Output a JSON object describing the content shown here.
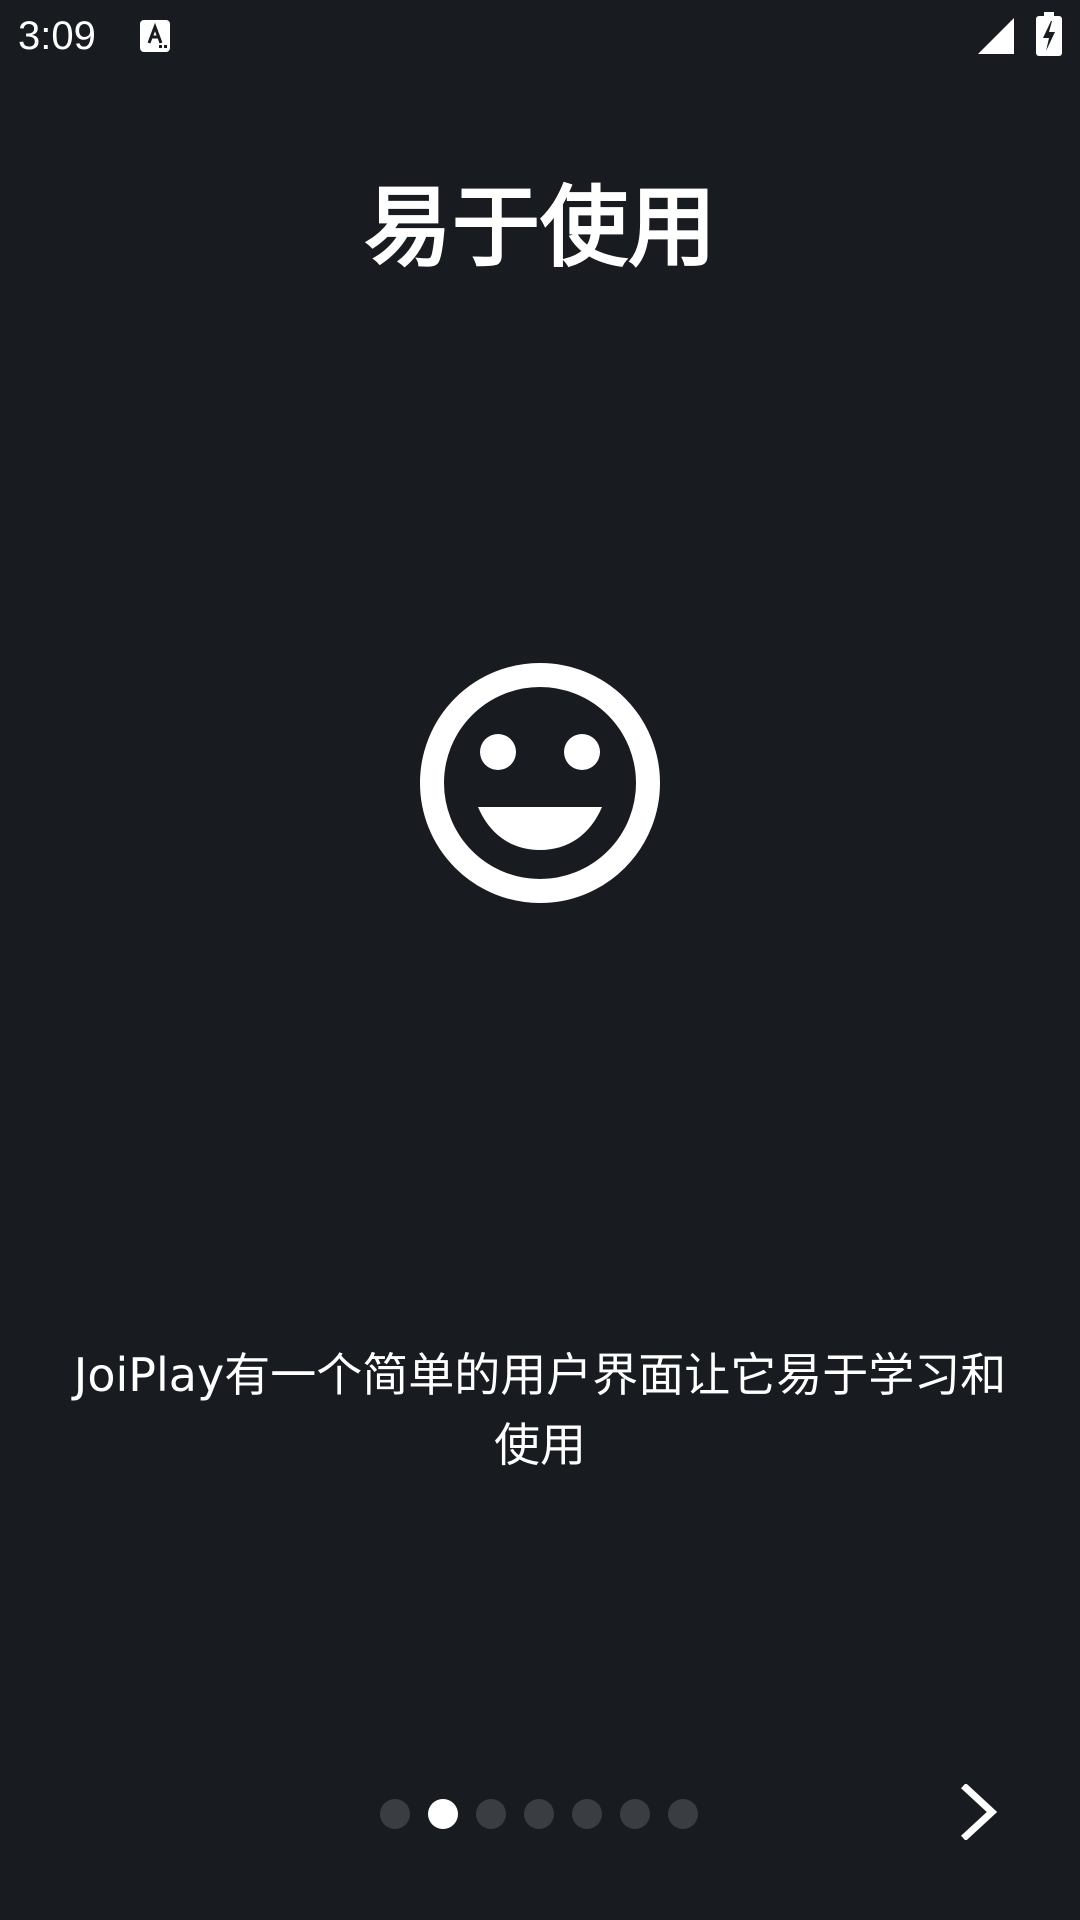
{
  "status_bar": {
    "time": "3:09",
    "icons": [
      "app-notification-icon",
      "signal-icon",
      "battery-charging-icon"
    ]
  },
  "onboarding": {
    "title": "易于使用",
    "hero_icon": "smiley-face-icon",
    "description_line1": "JoiPlay有一个简单的用户界面让它易于学习和",
    "description_line2": "使用",
    "pager": {
      "total_pages": 7,
      "current_page": 2
    },
    "next_icon": "chevron-right-icon"
  },
  "colors": {
    "background": "#181c20",
    "foreground": "#ffffff",
    "inactive_dot": "#3a3e43"
  }
}
